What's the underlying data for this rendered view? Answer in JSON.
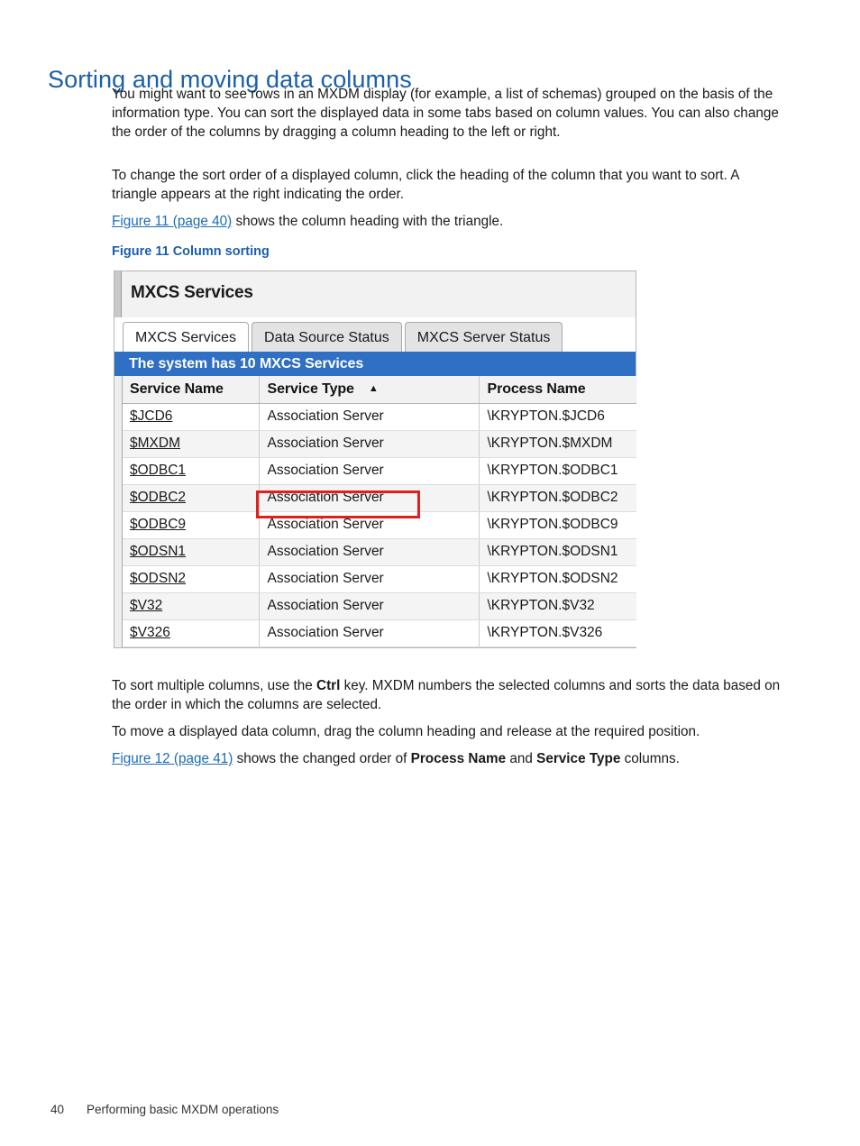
{
  "page": {
    "heading": "Sorting and moving data columns",
    "footer_page_number": "40",
    "footer_section": "Performing basic MXDM operations",
    "heading_color": "#1b5faa",
    "link_color": "#1b6cb3"
  },
  "body": {
    "para1": "You might want to see rows in an MXDM display (for example, a list of schemas) grouped on the basis of the information type. You can sort the displayed data in some tabs based on column values. You can also change the order of the columns by dragging a column heading to the left or right.",
    "para2": "To change the sort order of a displayed column, click the heading of the column that you want to sort. A triangle appears at the right indicating the order.",
    "para3_link": "Figure 11 (page 40)",
    "para3_rest": " shows the column heading with the triangle.",
    "para4_a": "To sort multiple columns, use the ",
    "para4_bold": "Ctrl",
    "para4_b": " key. MXDM numbers the selected columns and sorts the data based on the order in which the columns are selected.",
    "para5": "To move a displayed data column, drag the column heading and release at the required position.",
    "para6_link": "Figure 12 (page 41)",
    "para6_a": " shows the changed order of ",
    "para6_bold1": "Process Name",
    "para6_b": " and ",
    "para6_bold2": "Service Type",
    "para6_c": " columns."
  },
  "figure": {
    "caption": "Figure 11 Column sorting",
    "app_title": "MXCS Services",
    "tabs": [
      {
        "label": "MXCS Services",
        "active": true
      },
      {
        "label": "Data Source Status",
        "active": false
      },
      {
        "label": "MXCS Server Status",
        "active": false
      }
    ],
    "banner": "The system has 10 MXCS Services",
    "banner_color": "#2f6fc4",
    "highlight_color": "#e02020",
    "sort_arrow": "▲",
    "columns": [
      "Service Name",
      "Service Type",
      "Process Name"
    ],
    "sorted_column": "Service Type",
    "sort_direction": "ascending",
    "rows": [
      {
        "service_name": "$JCD6",
        "service_type": "Association Server",
        "process_name": "\\KRYPTON.$JCD6"
      },
      {
        "service_name": "$MXDM",
        "service_type": "Association Server",
        "process_name": "\\KRYPTON.$MXDM"
      },
      {
        "service_name": "$ODBC1",
        "service_type": "Association Server",
        "process_name": "\\KRYPTON.$ODBC1"
      },
      {
        "service_name": "$ODBC2",
        "service_type": "Association Server",
        "process_name": "\\KRYPTON.$ODBC2"
      },
      {
        "service_name": "$ODBC9",
        "service_type": "Association Server",
        "process_name": "\\KRYPTON.$ODBC9"
      },
      {
        "service_name": "$ODSN1",
        "service_type": "Association Server",
        "process_name": "\\KRYPTON.$ODSN1"
      },
      {
        "service_name": "$ODSN2",
        "service_type": "Association Server",
        "process_name": "\\KRYPTON.$ODSN2"
      },
      {
        "service_name": "$V32",
        "service_type": "Association Server",
        "process_name": "\\KRYPTON.$V32"
      },
      {
        "service_name": "$V326",
        "service_type": "Association Server",
        "process_name": "\\KRYPTON.$V326"
      }
    ]
  }
}
